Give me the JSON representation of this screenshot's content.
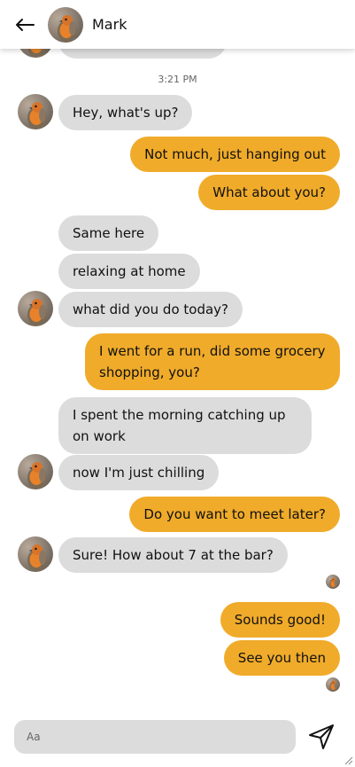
{
  "contact": {
    "name": "Mark"
  },
  "timestamp": "3:21 PM",
  "messages": [
    {
      "text": "Hey, what's up?"
    },
    {
      "text": "Not much, just hanging out"
    },
    {
      "text": "What about you?"
    },
    {
      "text": "Same here"
    },
    {
      "text": "relaxing at home"
    },
    {
      "text": "what did you do today?"
    },
    {
      "text": "I went for a run, did some grocery shopping, you?"
    },
    {
      "text": "I spent the morning catching up on work"
    },
    {
      "text": "now I'm just chilling"
    },
    {
      "text": "Do you want to meet later?"
    },
    {
      "text": "Sure! How about 7 at the bar?"
    },
    {
      "text": "Sounds good!"
    },
    {
      "text": "See you then"
    }
  ],
  "composer": {
    "placeholder": "Aa"
  },
  "colors": {
    "outgoing_bubble": "#f0ab2a",
    "incoming_bubble": "#dcdcdc",
    "header_bg": "#ffffff"
  },
  "icons": [
    "back-arrow-icon",
    "send-icon",
    "resize-grip-icon"
  ]
}
